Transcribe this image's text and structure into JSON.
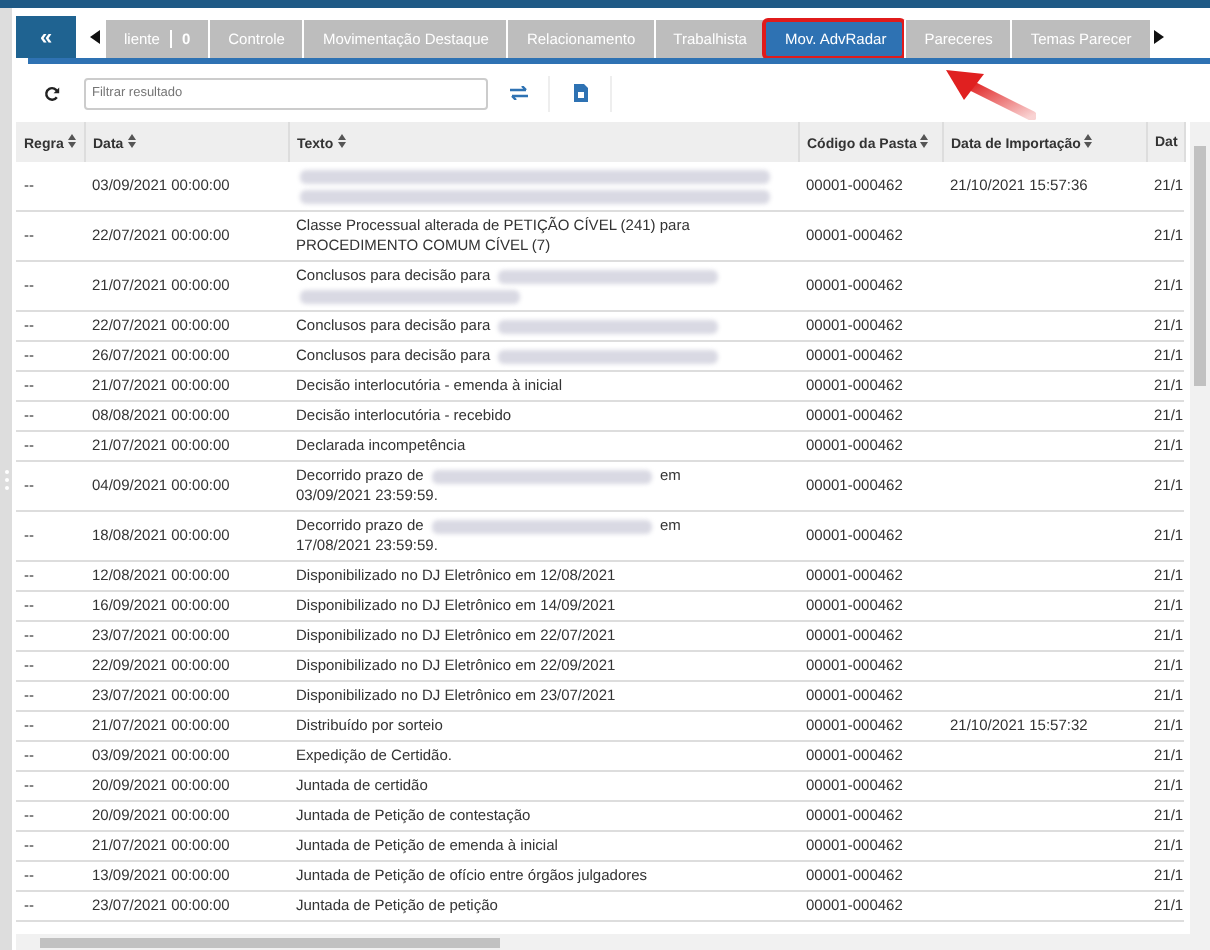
{
  "collapse_button": {
    "label": "«"
  },
  "tabs": [
    {
      "label": "liente",
      "badge": "0",
      "selected": false,
      "highlighted": false
    },
    {
      "label": "Controle",
      "selected": false,
      "highlighted": false
    },
    {
      "label": "Movimentação Destaque",
      "selected": false,
      "highlighted": false
    },
    {
      "label": "Relacionamento",
      "selected": false,
      "highlighted": false
    },
    {
      "label": "Trabalhista",
      "selected": false,
      "highlighted": false
    },
    {
      "label": "Mov. AdvRadar",
      "selected": true,
      "highlighted": true
    },
    {
      "label": "Pareceres",
      "selected": false,
      "highlighted": false
    },
    {
      "label": "Temas Parecer",
      "selected": false,
      "highlighted": false
    }
  ],
  "toolbar": {
    "search": {
      "placeholder": "Filtrar resultado"
    }
  },
  "table": {
    "columns": [
      {
        "label": "Regra",
        "sortable": true
      },
      {
        "label": "Data",
        "sortable": true
      },
      {
        "label": "Texto",
        "sortable": true
      },
      {
        "label": "Código da Pasta",
        "sortable": true
      },
      {
        "label": "Data de Importação",
        "sortable": true
      },
      {
        "label": "Dat",
        "sortable": false
      }
    ],
    "rows": [
      {
        "regra": "--",
        "data": "03/09/2021 00:00:00",
        "texto": [
          {
            "kind": "redacted-line"
          },
          {
            "kind": "redacted-line"
          }
        ],
        "codigo": "00001-000462",
        "importacao": "21/10/2021 15:57:36",
        "column_6": "21/1"
      },
      {
        "regra": "--",
        "data": "22/07/2021 00:00:00",
        "texto": [
          {
            "kind": "text",
            "text": "Classe Processual alterada de PETIÇÃO CÍVEL (241) para PROCEDIMENTO COMUM CÍVEL (7)"
          }
        ],
        "codigo": "00001-000462",
        "column_6": "21/1"
      },
      {
        "regra": "--",
        "data": "21/07/2021 00:00:00",
        "texto": [
          {
            "kind": "text",
            "text": "Conclusos para decisão para"
          },
          {
            "kind": "redacted"
          },
          {
            "kind": "redacted"
          }
        ],
        "codigo": "00001-000462",
        "column_6": "21/1"
      },
      {
        "regra": "--",
        "data": "22/07/2021 00:00:00",
        "texto": [
          {
            "kind": "text",
            "text": "Conclusos para decisão para"
          },
          {
            "kind": "redacted"
          }
        ],
        "codigo": "00001-000462",
        "column_6": "21/1"
      },
      {
        "regra": "--",
        "data": "26/07/2021 00:00:00",
        "texto": [
          {
            "kind": "text",
            "text": "Conclusos para decisão para"
          },
          {
            "kind": "redacted"
          }
        ],
        "codigo": "00001-000462",
        "column_6": "21/1"
      },
      {
        "regra": "--",
        "data": "21/07/2021 00:00:00",
        "texto": [
          {
            "kind": "text",
            "text": "Decisão interlocutória - emenda à inicial"
          }
        ],
        "codigo": "00001-000462",
        "column_6": "21/1"
      },
      {
        "regra": "--",
        "data": "08/08/2021 00:00:00",
        "texto": [
          {
            "kind": "text",
            "text": "Decisão interlocutória - recebido"
          }
        ],
        "codigo": "00001-000462",
        "column_6": "21/1"
      },
      {
        "regra": "--",
        "data": "21/07/2021 00:00:00",
        "texto": [
          {
            "kind": "text",
            "text": "Declarada incompetência"
          }
        ],
        "codigo": "00001-000462",
        "column_6": "21/1"
      },
      {
        "regra": "--",
        "data": "04/09/2021 00:00:00",
        "texto": [
          {
            "kind": "text",
            "text": "Decorrido prazo de"
          },
          {
            "kind": "redacted"
          },
          {
            "kind": "text",
            "text": "em"
          },
          {
            "kind": "text",
            "text": "03/09/2021 23:59:59."
          }
        ],
        "codigo": "00001-000462",
        "column_6": "21/1"
      },
      {
        "regra": "--",
        "data": "18/08/2021 00:00:00",
        "texto": [
          {
            "kind": "text",
            "text": "Decorrido prazo de"
          },
          {
            "kind": "redacted"
          },
          {
            "kind": "text",
            "text": "em"
          },
          {
            "kind": "text",
            "text": "17/08/2021 23:59:59."
          }
        ],
        "codigo": "00001-000462",
        "column_6": "21/1"
      },
      {
        "regra": "--",
        "data": "12/08/2021 00:00:00",
        "texto": [
          {
            "kind": "text",
            "text": "Disponibilizado no DJ Eletrônico em 12/08/2021"
          }
        ],
        "codigo": "00001-000462",
        "column_6": "21/1"
      },
      {
        "regra": "--",
        "data": "16/09/2021 00:00:00",
        "texto": [
          {
            "kind": "text",
            "text": "Disponibilizado no DJ Eletrônico em 14/09/2021"
          }
        ],
        "codigo": "00001-000462",
        "column_6": "21/1"
      },
      {
        "regra": "--",
        "data": "23/07/2021 00:00:00",
        "texto": [
          {
            "kind": "text",
            "text": "Disponibilizado no DJ Eletrônico em 22/07/2021"
          }
        ],
        "codigo": "00001-000462",
        "column_6": "21/1"
      },
      {
        "regra": "--",
        "data": "22/09/2021 00:00:00",
        "texto": [
          {
            "kind": "text",
            "text": "Disponibilizado no DJ Eletrônico em 22/09/2021"
          }
        ],
        "codigo": "00001-000462",
        "column_6": "21/1"
      },
      {
        "regra": "--",
        "data": "23/07/2021 00:00:00",
        "texto": [
          {
            "kind": "text",
            "text": "Disponibilizado no DJ Eletrônico em 23/07/2021"
          }
        ],
        "codigo": "00001-000462",
        "column_6": "21/1"
      },
      {
        "regra": "--",
        "data": "21/07/2021 00:00:00",
        "texto": [
          {
            "kind": "text",
            "text": "Distribuído por sorteio"
          }
        ],
        "codigo": "00001-000462",
        "importacao": "21/10/2021 15:57:32",
        "column_6": "21/1"
      },
      {
        "regra": "--",
        "data": "03/09/2021 00:00:00",
        "texto": [
          {
            "kind": "text",
            "text": "Expedição de Certidão."
          }
        ],
        "codigo": "00001-000462",
        "column_6": "21/1"
      },
      {
        "regra": "--",
        "data": "20/09/2021 00:00:00",
        "texto": [
          {
            "kind": "text",
            "text": "Juntada de certidão"
          }
        ],
        "codigo": "00001-000462",
        "column_6": "21/1"
      },
      {
        "regra": "--",
        "data": "20/09/2021 00:00:00",
        "texto": [
          {
            "kind": "text",
            "text": "Juntada de Petição de contestação"
          }
        ],
        "codigo": "00001-000462",
        "column_6": "21/1"
      },
      {
        "regra": "--",
        "data": "21/07/2021 00:00:00",
        "texto": [
          {
            "kind": "text",
            "text": "Juntada de Petição de emenda à inicial"
          }
        ],
        "codigo": "00001-000462",
        "column_6": "21/1"
      },
      {
        "regra": "--",
        "data": "13/09/2021 00:00:00",
        "texto": [
          {
            "kind": "text",
            "text": "Juntada de Petição de ofício entre órgãos julgadores"
          }
        ],
        "codigo": "00001-000462",
        "column_6": "21/1"
      },
      {
        "regra": "--",
        "data": "23/07/2021 00:00:00",
        "texto": [
          {
            "kind": "text",
            "text": "Juntada de Petição de petição"
          }
        ],
        "codigo": "00001-000462",
        "column_6": "21/1"
      }
    ]
  }
}
